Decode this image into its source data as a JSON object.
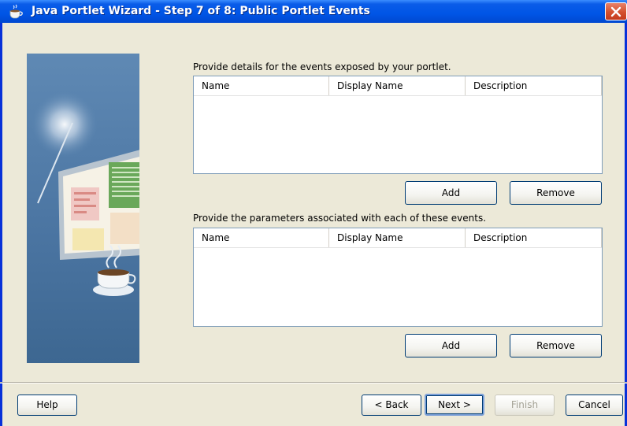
{
  "window": {
    "title": "Java Portlet Wizard - Step 7 of 8: Public Portlet Events",
    "close_icon": "close-icon",
    "app_icon": "java-cup-icon"
  },
  "events_section": {
    "label": "Provide details for the events exposed by your portlet.",
    "columns": [
      "Name",
      "Display Name",
      "Description"
    ],
    "rows": [],
    "add_label": "Add",
    "remove_label": "Remove"
  },
  "parameters_section": {
    "label": "Provide the parameters associated with each of these events.",
    "columns": [
      "Name",
      "Display Name",
      "Description"
    ],
    "rows": [],
    "add_label": "Add",
    "remove_label": "Remove"
  },
  "footer": {
    "help_label": "Help",
    "back_label": "< Back",
    "next_label": "Next >",
    "finish_label": "Finish",
    "cancel_label": "Cancel"
  }
}
